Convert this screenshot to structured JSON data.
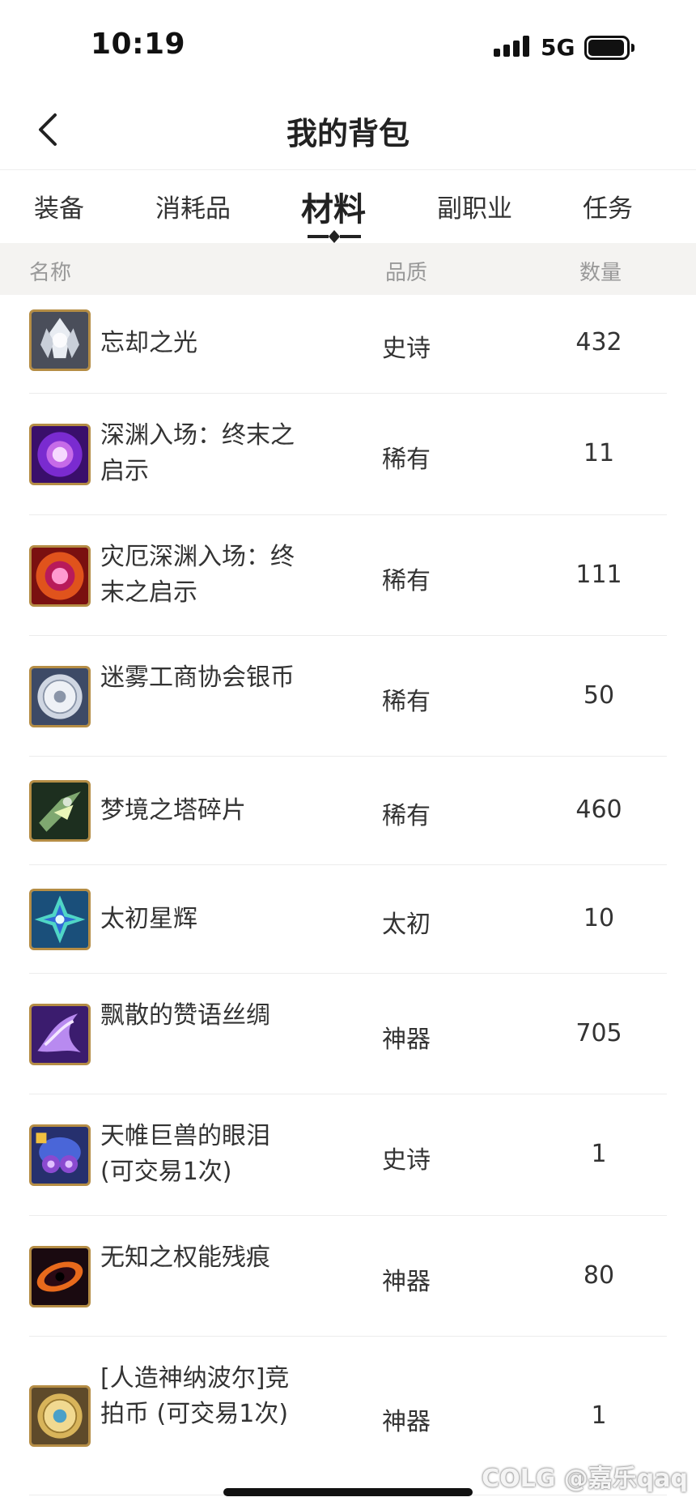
{
  "status": {
    "time": "10:19",
    "network": "5G"
  },
  "header": {
    "title": "我的背包",
    "back_icon": "chevron-left-icon"
  },
  "tabs": [
    {
      "label": "装备",
      "active": false
    },
    {
      "label": "消耗品",
      "active": false
    },
    {
      "label": "材料",
      "active": true
    },
    {
      "label": "副职业",
      "active": false
    },
    {
      "label": "任务",
      "active": false
    }
  ],
  "table": {
    "headers": {
      "name": "名称",
      "quality": "品质",
      "quantity": "数量"
    },
    "rows": [
      {
        "name": "忘却之光",
        "quality": "史诗",
        "quantity": "432",
        "icon": "light-crystal-icon"
      },
      {
        "name": "深渊入场：终末之启示",
        "quality": "稀有",
        "quantity": "11",
        "icon": "purple-orb-icon"
      },
      {
        "name": "灾厄深渊入场：终末之启示",
        "quality": "稀有",
        "quantity": "111",
        "icon": "red-orb-icon"
      },
      {
        "name": "迷雾工商协会银币",
        "quality": "稀有",
        "quantity": "50",
        "icon": "silver-coin-icon"
      },
      {
        "name": "梦境之塔碎片",
        "quality": "稀有",
        "quantity": "460",
        "icon": "green-shard-icon"
      },
      {
        "name": "太初星辉",
        "quality": "太初",
        "quantity": "10",
        "icon": "star-gem-icon"
      },
      {
        "name": "飘散的赞语丝绸",
        "quality": "神器",
        "quantity": "705",
        "icon": "silk-icon"
      },
      {
        "name": "天帷巨兽的眼泪 (可交易1次)",
        "quality": "史诗",
        "quantity": "1",
        "icon": "beast-tear-icon"
      },
      {
        "name": "无知之权能残痕",
        "quality": "神器",
        "quantity": "80",
        "icon": "vortex-icon"
      },
      {
        "name": "[人造神纳波尔]竞拍币 (可交易1次)",
        "quality": "神器",
        "quantity": "1",
        "icon": "gold-coin-icon"
      }
    ]
  },
  "watermark": "COLG @嘉乐qaq",
  "colors": {
    "accent": "#222222",
    "header_bg": "#f4f3f1",
    "icon_border": "#b58d45"
  }
}
